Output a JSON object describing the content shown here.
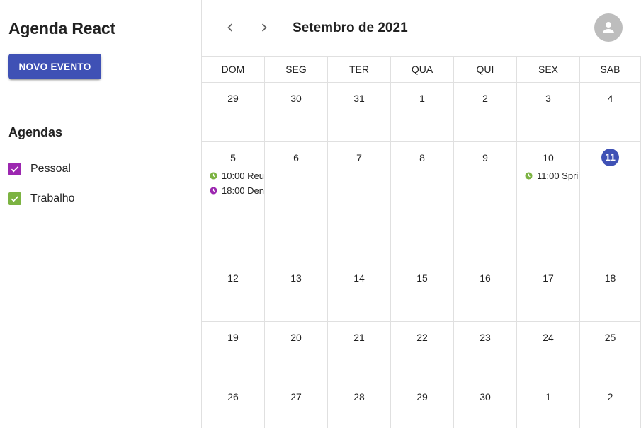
{
  "sidebar": {
    "app_title": "Agenda React",
    "new_event_label": "NOVO EVENTO",
    "agendas_title": "Agendas",
    "agendas": [
      {
        "label": "Pessoal",
        "checked": true,
        "color": "#9c27b0"
      },
      {
        "label": "Trabalho",
        "checked": true,
        "color": "#7cb342"
      }
    ]
  },
  "header": {
    "month_title": "Setembro de 2021",
    "prev_icon": "chevron-left-icon",
    "next_icon": "chevron-right-icon",
    "avatar_icon": "person-icon"
  },
  "calendar": {
    "weekdays": [
      "DOM",
      "SEG",
      "TER",
      "QUA",
      "QUI",
      "SEX",
      "SAB"
    ],
    "today_color": "#3f51b5",
    "weeks": [
      {
        "days": [
          {
            "label": "29",
            "events": []
          },
          {
            "label": "30",
            "events": []
          },
          {
            "label": "31",
            "events": []
          },
          {
            "label": "1",
            "events": []
          },
          {
            "label": "2",
            "events": []
          },
          {
            "label": "3",
            "events": []
          },
          {
            "label": "4",
            "events": []
          }
        ]
      },
      {
        "days": [
          {
            "label": "5",
            "events": [
              {
                "text": "10:00 Reu",
                "color": "#7cb342"
              },
              {
                "text": "18:00 Den",
                "color": "#9c27b0"
              }
            ]
          },
          {
            "label": "6",
            "events": []
          },
          {
            "label": "7",
            "events": []
          },
          {
            "label": "8",
            "events": []
          },
          {
            "label": "9",
            "events": []
          },
          {
            "label": "10",
            "events": [
              {
                "text": "11:00 Spri",
                "color": "#7cb342"
              }
            ]
          },
          {
            "label": "11",
            "today": true,
            "events": []
          }
        ]
      },
      {
        "days": [
          {
            "label": "12",
            "events": []
          },
          {
            "label": "13",
            "events": []
          },
          {
            "label": "14",
            "events": []
          },
          {
            "label": "15",
            "events": []
          },
          {
            "label": "16",
            "events": []
          },
          {
            "label": "17",
            "events": []
          },
          {
            "label": "18",
            "events": []
          }
        ]
      },
      {
        "days": [
          {
            "label": "19",
            "events": []
          },
          {
            "label": "20",
            "events": []
          },
          {
            "label": "21",
            "events": []
          },
          {
            "label": "22",
            "events": []
          },
          {
            "label": "23",
            "events": []
          },
          {
            "label": "24",
            "events": []
          },
          {
            "label": "25",
            "events": []
          }
        ]
      },
      {
        "days": [
          {
            "label": "26",
            "events": []
          },
          {
            "label": "27",
            "events": []
          },
          {
            "label": "28",
            "events": []
          },
          {
            "label": "29",
            "events": []
          },
          {
            "label": "30",
            "events": []
          },
          {
            "label": "1",
            "events": []
          },
          {
            "label": "2",
            "events": []
          }
        ]
      }
    ]
  }
}
